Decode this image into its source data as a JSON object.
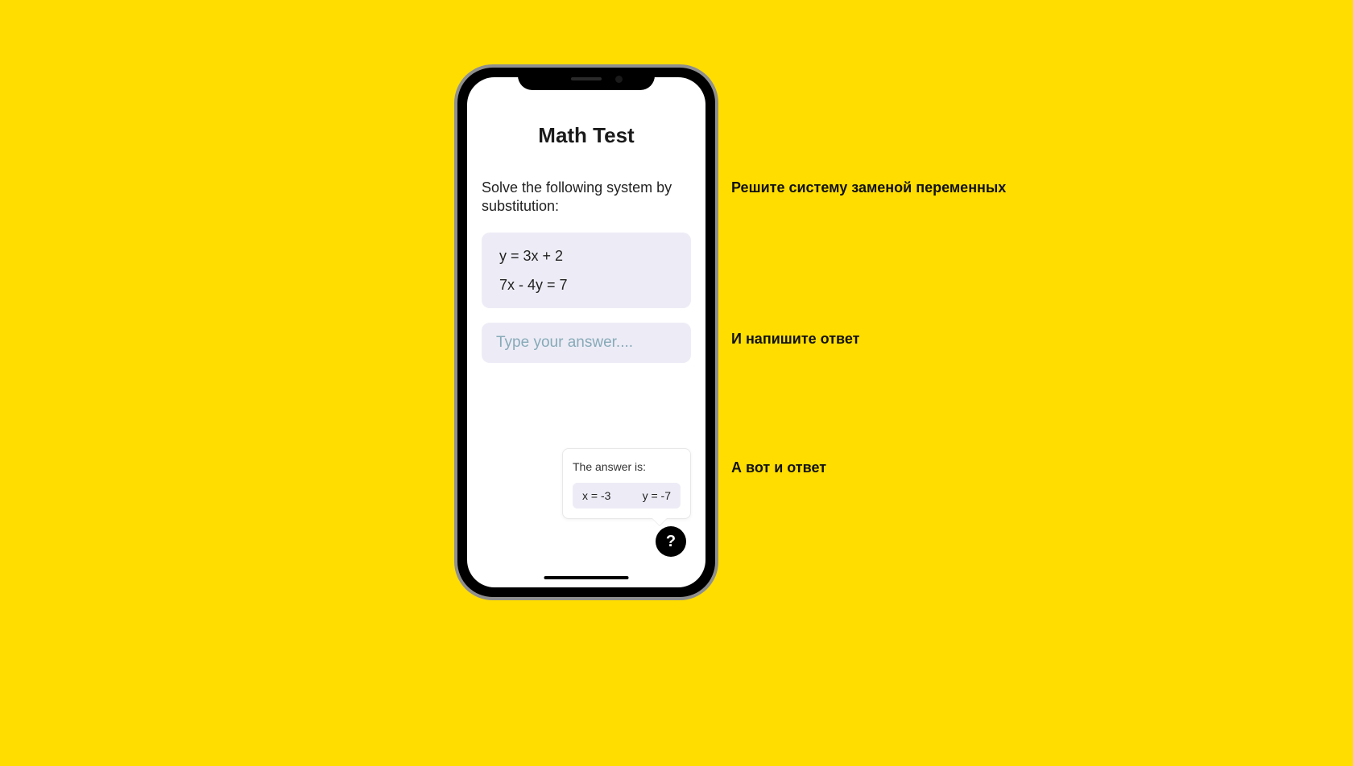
{
  "app": {
    "title": "Math Test",
    "prompt": "Solve the following system by substitution:",
    "equations": [
      "y = 3x + 2",
      "7x - 4y = 7"
    ],
    "input_placeholder": "Type your answer....",
    "tooltip": {
      "title": "The answer is:",
      "x": "x = -3",
      "y": "y = -7"
    },
    "help_label": "?"
  },
  "annotations": {
    "top": "Решите систему заменой переменных",
    "middle": "И напишите ответ",
    "bottom": "А вот и ответ"
  }
}
